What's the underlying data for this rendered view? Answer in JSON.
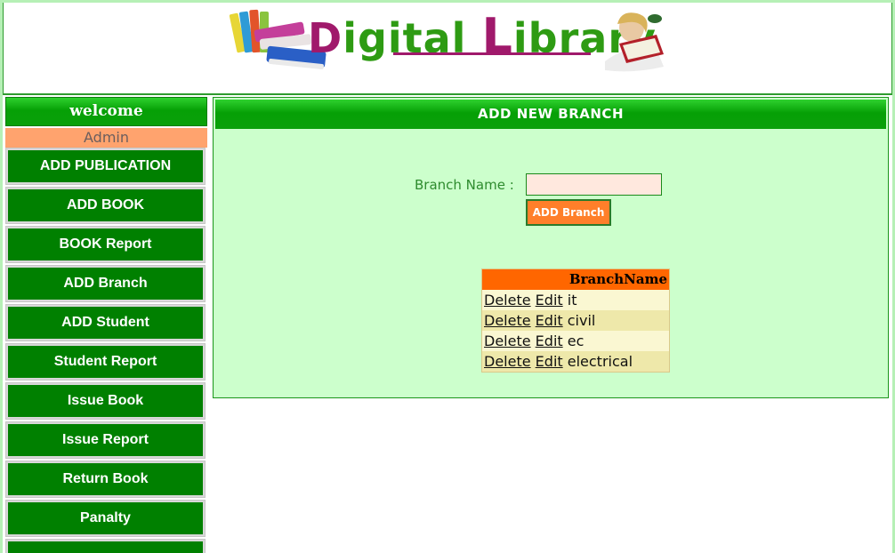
{
  "header": {
    "logo": {
      "word1": "Digital",
      "word2_initial": "L",
      "word2_rest": "ibrary"
    }
  },
  "sidebar": {
    "welcome_label": "welcome",
    "user_label": "Admin",
    "menu": [
      "ADD PUBLICATION",
      "ADD BOOK",
      "BOOK Report",
      "ADD Branch",
      "ADD Student",
      "Student Report",
      "Issue Book",
      "Issue Report",
      "Return Book",
      "Panalty",
      ""
    ]
  },
  "main": {
    "title": "ADD NEW BRANCH",
    "form": {
      "label": "Branch Name :",
      "value": "",
      "button_label": "ADD Branch"
    },
    "table": {
      "header": "BranchName",
      "delete_label": "Delete",
      "edit_label": "Edit",
      "rows": [
        "it",
        "civil",
        "ec",
        "electrical"
      ]
    }
  },
  "colors": {
    "accent_green": "#008000",
    "panel_bg": "#ccffcc",
    "orange": "#ff6600",
    "admin_bar": "#ffa36e",
    "logo_magenta": "#a0196b",
    "logo_green": "#2e9b13"
  },
  "icons": {
    "logo_books": "stack-of-books-icon",
    "logo_reader": "reading-girl-icon"
  }
}
